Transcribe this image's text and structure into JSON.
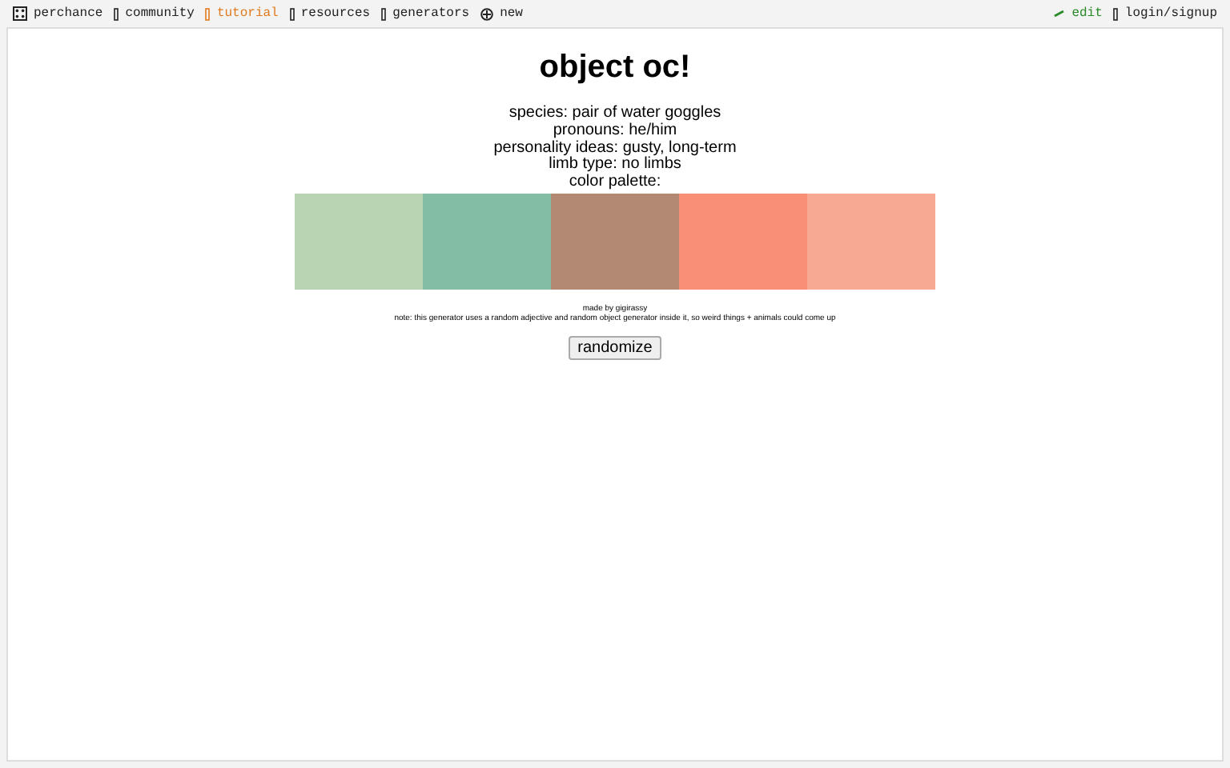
{
  "nav": {
    "left": [
      {
        "kind": "logo",
        "label": "perchance",
        "selected": false
      },
      {
        "kind": "box",
        "label": "community",
        "selected": false
      },
      {
        "kind": "box",
        "label": "tutorial",
        "selected": true
      },
      {
        "kind": "box",
        "label": "resources",
        "selected": false
      },
      {
        "kind": "box",
        "label": "generators",
        "selected": false
      },
      {
        "kind": "plus",
        "label": "new",
        "selected": false
      }
    ],
    "right": [
      {
        "kind": "pencil",
        "label": "edit"
      },
      {
        "kind": "box",
        "label": "login/signup"
      }
    ]
  },
  "title": "object oc!",
  "details": [
    "species: pair of water goggles",
    "pronouns: he/him",
    "personality ideas: gusty, long-term",
    "limb type: no limbs",
    "color palette:"
  ],
  "palette": [
    {
      "color": "#b9d4b2"
    },
    {
      "color": "#84bda6"
    },
    {
      "color": "#b38973"
    },
    {
      "color": "#f98f77"
    },
    {
      "color": "#f7a993"
    }
  ],
  "credit": "made by gigirassy",
  "note": "note: this generator uses a random adjective and random object generator inside it, so weird things + animals could come up",
  "button": "randomize"
}
